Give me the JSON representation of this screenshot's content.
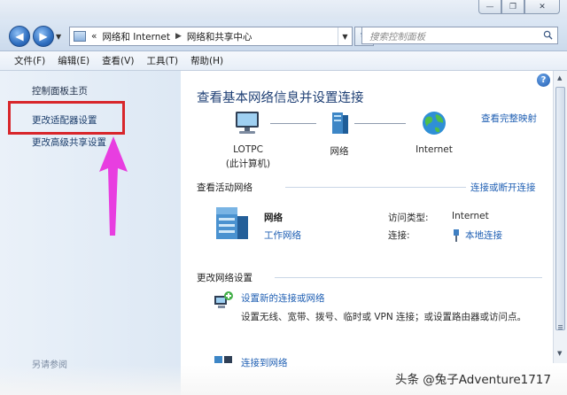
{
  "window": {
    "buttons": {
      "minimize": "—",
      "maximize": "❐",
      "close": "✕"
    }
  },
  "nav": {
    "back_icon": "back-arrow-icon",
    "forward_icon": "forward-arrow-icon",
    "breadcrumb_prefix": "«",
    "breadcrumb": [
      "网络和 Internet",
      "网络和共享中心"
    ],
    "refresh_label": "↻",
    "search_placeholder": "搜索控制面板"
  },
  "menu": {
    "items": [
      "文件(F)",
      "编辑(E)",
      "查看(V)",
      "工具(T)",
      "帮助(H)"
    ]
  },
  "sidebar": {
    "home": "控制面板主页",
    "adapter_settings": "更改适配器设置",
    "advanced_sharing": "更改高级共享设置",
    "see_also": "另请参阅"
  },
  "main": {
    "title": "查看基本网络信息并设置连接",
    "full_map_link": "查看完整映射",
    "map": {
      "computer": "LOTPC",
      "computer_sub": "(此计算机)",
      "network": "网络",
      "internet": "Internet"
    },
    "active_networks": {
      "header": "查看活动网络",
      "connect_link": "连接或断开连接",
      "network_name": "网络",
      "network_type": "工作网络",
      "access_type_label": "访问类型:",
      "access_type_value": "Internet",
      "connections_label": "连接:",
      "connections_value": "本地连接"
    },
    "change_settings": {
      "header": "更改网络设置",
      "task1_link": "设置新的连接或网络",
      "task1_desc": "设置无线、宽带、拨号、临时或 VPN 连接；或设置路由器或访问点。",
      "task2_link": "连接到网络"
    },
    "help_label": "?"
  },
  "watermark": "头条 @兔子Adventure1717",
  "colors": {
    "accent_link": "#1f5fb3",
    "title_blue": "#1e3f74",
    "highlight_red": "#d8262b",
    "arrow_magenta": "#e83ee0"
  }
}
